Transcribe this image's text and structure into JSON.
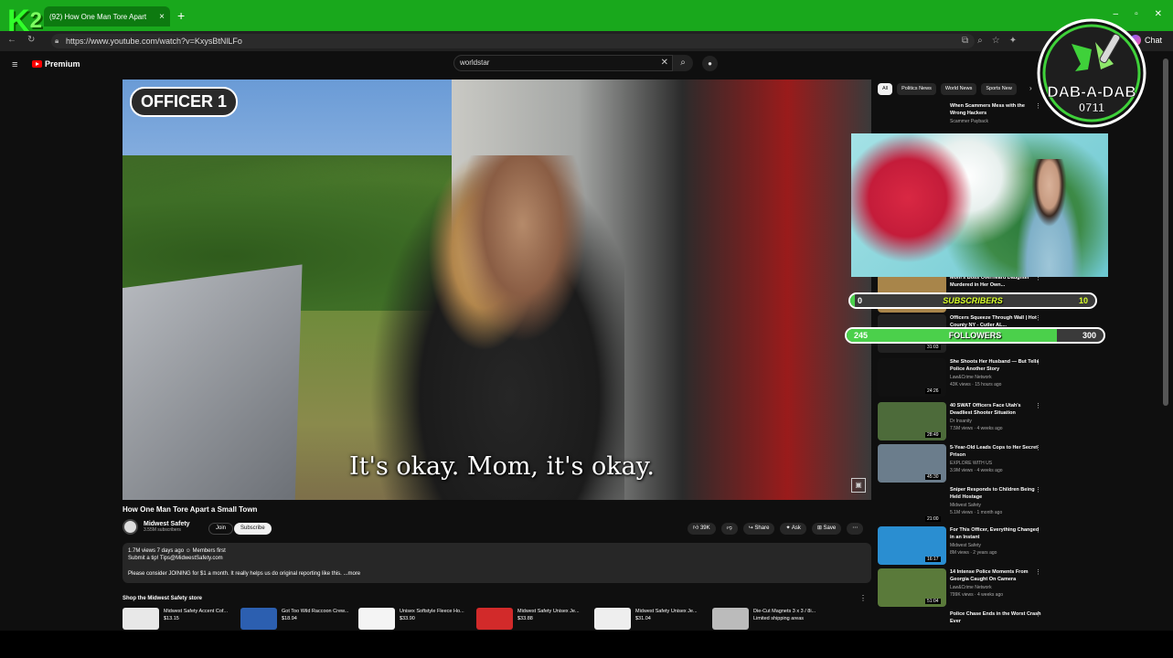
{
  "browser": {
    "tab_title": "(92) How One Man Tore Apart",
    "url": "https://www.youtube.com/watch?v=KxysBtNlLFo",
    "chat_label": "Chat",
    "k2_logo": "K2"
  },
  "youtube": {
    "premium_label": "Premium",
    "search_query": "worldstar"
  },
  "video": {
    "officer_label": "OFFICER 1",
    "caption": "It's okay. Mom, it's okay.",
    "title": "How One Man Tore Apart a Small Town",
    "channel": "Midwest Safety",
    "subscribers": "3.55M subscribers",
    "join_label": "Join",
    "subscribe_label": "Subscribe",
    "actions": {
      "likes": "39K",
      "share": "Share",
      "ask": "Ask",
      "save": "Save"
    },
    "desc_line1": "1.7M views  7 days ago  ☺ Members first",
    "desc_line2": "Submit a tip! Tips@MidwestSafety.com",
    "desc_line3": "Please consider JOINING for $1 a month. It really helps us do original reporting like this.  ...more"
  },
  "shop": {
    "label": "Shop the Midwest Safety store",
    "items": [
      {
        "name": "Midwest Safety Accent Cof...",
        "price": "$13.15"
      },
      {
        "name": "Got Too Wild Raccoon Crew...",
        "price": "$18.94"
      },
      {
        "name": "Unisex Softstyle Fleece Ho...",
        "price": "$33.90"
      },
      {
        "name": "Midwest Safety Unisex Je...",
        "price": "$33.88"
      },
      {
        "name": "Midwest Safety Unisex Je...",
        "price": "$31.04"
      },
      {
        "name": "Die-Cut Magnets 3 x 3 / 8i...",
        "price": "Limited shipping areas"
      }
    ]
  },
  "sidebar": {
    "chips": [
      "All",
      "Politics News",
      "World News",
      "Sports New"
    ],
    "recs": [
      {
        "title": "When Scammers Mess with the Wrong Hackers",
        "channel": "Scammer Payback",
        "meta": "",
        "duration": ""
      },
      {
        "title": "Mom's Boss Overheard Daughter Murdered in Her Own...",
        "channel": "",
        "meta": "",
        "duration": ""
      },
      {
        "title": "Officers Squeeze Through Wall | Hot County NY - Cutler AL...",
        "channel": "",
        "meta": "",
        "duration": "31:03"
      },
      {
        "title": "She Shoots Her Husband — But Tells Police Another Story",
        "channel": "Law&Crime Network",
        "meta": "43K views · 15 hours ago",
        "duration": "24:26"
      },
      {
        "title": "40 SWAT Officers Face Utah's Deadliest Shooter Situation",
        "channel": "Dr Insanity",
        "meta": "7.5M views · 4 weeks ago",
        "duration": "28:49"
      },
      {
        "title": "5-Year-Old Leads Cops to Her Secret Prison",
        "channel": "EXPLORE WITH US",
        "meta": "3.9M views · 4 weeks ago",
        "duration": "45:30"
      },
      {
        "title": "Sniper Responds to Children Being Held Hostage",
        "channel": "Midwest Safety",
        "meta": "5.1M views · 1 month ago",
        "duration": "21:00"
      },
      {
        "title": "For This Officer, Everything Changed in an Instant",
        "channel": "Midwest Safety",
        "meta": "8M views · 2 years ago",
        "duration": "16:17"
      },
      {
        "title": "14 Intense Police Moments From Georgia Caught On Camera",
        "channel": "Law&Crime Network",
        "meta": "799K views · 4 weeks ago",
        "duration": "51:04"
      },
      {
        "title": "Police Chase Ends in the Worst Crash Ever",
        "channel": "",
        "meta": "",
        "duration": ""
      }
    ]
  },
  "overlay": {
    "subscribers_label": "SUBSCRIBERS",
    "subscribers_current": "0",
    "subscribers_goal": "10",
    "subscribers_fraction": 0.02,
    "followers_label": "FOLLOWERS",
    "followers_current": "245",
    "followers_goal": "300",
    "followers_fraction": 0.82,
    "logo_text": "DAB-A-DAB",
    "logo_number": "0711"
  },
  "icons": {
    "tab_close": "×",
    "new_tab": "+",
    "menu": "≡",
    "search": "⌕",
    "clear": "✕",
    "mic": "●",
    "kebab": "⋮",
    "chevron": "›"
  },
  "colors": {
    "tabbar": "#19a81c",
    "progress_fill": "#4bd04b",
    "subscribers_text": "#d8ff2a"
  }
}
